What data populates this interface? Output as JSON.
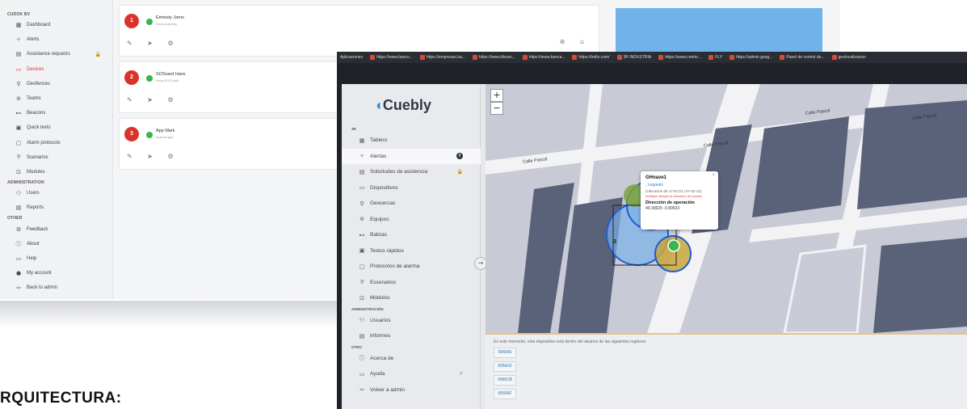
{
  "back_app": {
    "org": "CUDOK BV",
    "nav": [
      {
        "label": "Dashboard",
        "icon": "▦"
      },
      {
        "label": "Alerts",
        "icon": "✧"
      },
      {
        "label": "Assistance requests",
        "icon": "▤",
        "lock": "🔒"
      },
      {
        "label": "Devices",
        "icon": "▭",
        "active": true
      },
      {
        "label": "Geofences",
        "icon": "⚲"
      },
      {
        "label": "Teams",
        "icon": "⊘"
      },
      {
        "label": "Beacons",
        "icon": "⊷"
      },
      {
        "label": "Quick texts",
        "icon": "▣"
      },
      {
        "label": "Alarm protocols",
        "icon": "▢"
      },
      {
        "label": "Scenarios",
        "icon": "⅌"
      },
      {
        "label": "Modules",
        "icon": "⊡"
      }
    ],
    "section_admin": "ADMINISTRATION",
    "admin_nav": [
      {
        "label": "Users",
        "icon": "⚇"
      },
      {
        "label": "Reports",
        "icon": "▤"
      }
    ],
    "section_other": "OTHER",
    "other_nav": [
      {
        "label": "Feedback",
        "icon": "⚙"
      },
      {
        "label": "About",
        "icon": "ⓘ"
      },
      {
        "label": "Help",
        "icon": "▭"
      },
      {
        "label": "My account",
        "icon": "●"
      },
      {
        "label": "Back to admin",
        "icon": "⇦"
      }
    ],
    "devices": [
      {
        "num": "1",
        "name": "Emtesty Jamo",
        "sub": "Hoog lompelig"
      },
      {
        "num": "2",
        "name": "SOSsard Hans",
        "sub": "Hoog SOS pakt"
      },
      {
        "num": "3",
        "name": "App Mark",
        "sub": "Android app"
      }
    ],
    "action_icons": "✎ ➤ ⚙",
    "right_icons": "⊕ ⌂"
  },
  "heading": "RQUITECTURA:",
  "front_app": {
    "bookmarks": [
      "Aplicaciones",
      "https://www.banco...",
      "https://empresas.ba...",
      "https://www.bbvan...",
      "https://www.banca...",
      "https://trello.com/",
      "3R INDUSTRIA",
      "https://www.centro...",
      "FLY",
      "https://admin.goog...",
      "Panel de control de...",
      "geolocalizacion"
    ],
    "logo": "Cuebly",
    "logo_mark": "◖",
    "org": "3R",
    "nav": [
      {
        "label": "Tablero",
        "icon": "▦"
      },
      {
        "label": "Alertas",
        "icon": "✧",
        "badge": "8",
        "active": true
      },
      {
        "label": "Solicitudes de asistencia",
        "icon": "▤",
        "lock": "🔒"
      },
      {
        "label": "Dispositivos",
        "icon": "▭"
      },
      {
        "label": "Geocercas",
        "icon": "⚲"
      },
      {
        "label": "Equipos",
        "icon": "⊘"
      },
      {
        "label": "Balizas",
        "icon": "⊷"
      },
      {
        "label": "Textos rápidos",
        "icon": "▣"
      },
      {
        "label": "Protocolos de alarma",
        "icon": "▢"
      },
      {
        "label": "Escenarios",
        "icon": "⅌"
      },
      {
        "label": "Módulos",
        "icon": "⊡"
      }
    ],
    "section_admin": "ADMINISTRACIÓN",
    "admin_nav": [
      {
        "label": "Usuarios",
        "icon": "⚇"
      },
      {
        "label": "Informes",
        "icon": "▤"
      }
    ],
    "section_other": "OTRO",
    "other_nav": [
      {
        "label": "Acerca de",
        "icon": "ⓘ"
      },
      {
        "label": "Ayuda",
        "icon": "▭",
        "ext": "↗"
      },
      {
        "label": "Volver a admin",
        "icon": "⇦"
      }
    ],
    "collapse_icon": "→",
    "zoom_in": "+",
    "zoom_out": "−",
    "streets": [
      "Calle Pascal",
      "Calle Pascal",
      "Calle Pascal",
      "Calle Pascal"
    ],
    "popup": {
      "title": "GHnave1",
      "location": ", Leganés",
      "updated": "(Ubicación de 17:52:24 | 07-02-22)",
      "warning": "Verifique siempre la ubicación del usuario",
      "op_header": "Dirección de operación",
      "coords": "40.30625 -3.80633",
      "close": "×",
      "marker_label": "3"
    },
    "bottom_note": "En este momento, este dispositivo está dentro del alcance de las siguientes regiones",
    "regions": [
      "006666",
      "005E03",
      "0066CB",
      "00666F"
    ],
    "colors": {
      "brand": "#2b8ed6",
      "alert_red": "#d9342b",
      "online": "#3ab54a",
      "highlight_blue": "#6fb3ea"
    }
  }
}
